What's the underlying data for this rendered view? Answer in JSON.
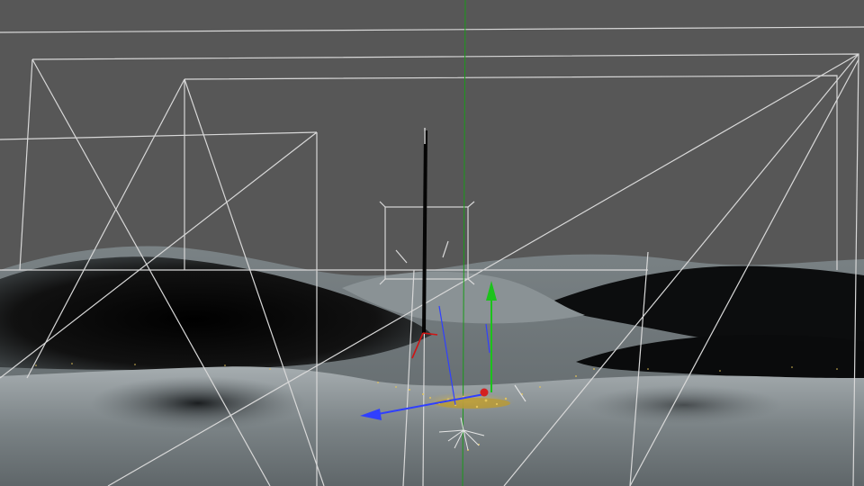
{
  "viewport": {
    "background_color": "#575757",
    "wireframe_color": "#d8d8d8",
    "dunes_color": "#6f7679",
    "dune_shadow_color": "#0a0a0a",
    "particles_color": "#d8b84a",
    "axis": {
      "x_color": "#2f3fff",
      "y_color": "#1cc21c",
      "z_color": "#d01414",
      "vertical_guide_color": "#1a9a1a"
    }
  },
  "objects": [
    "terrain-mesh",
    "camera-frustum-outer",
    "camera-frustum-mid",
    "camera-frustum-inner",
    "null-object-box",
    "emitter-pole",
    "particle-cloud",
    "move-gizmo"
  ]
}
